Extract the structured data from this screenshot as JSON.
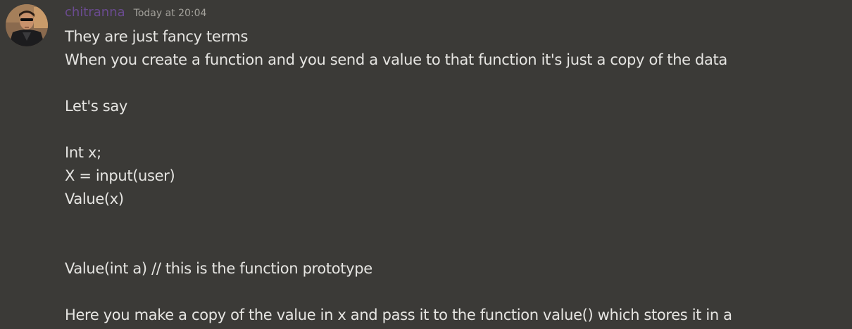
{
  "message": {
    "username": "chitranna",
    "timestamp": "Today at 20:04",
    "avatar_icon": "user-avatar-sunglasses-icon",
    "colors": {
      "background": "#3b3a37",
      "username": "#6a4b8f",
      "timestamp": "#a3a19b",
      "text": "#e6e5e2"
    },
    "lines": [
      "They are just fancy terms",
      "When you create a function and you send a value to that function it's just a copy of the data",
      "",
      "Let's say",
      "",
      "Int x;",
      "X = input(user)",
      "Value(x)",
      "",
      "",
      "Value(int a) // this is the function prototype",
      "",
      "Here you make a copy of the value in x and pass it to the function value() which stores it in a"
    ]
  }
}
